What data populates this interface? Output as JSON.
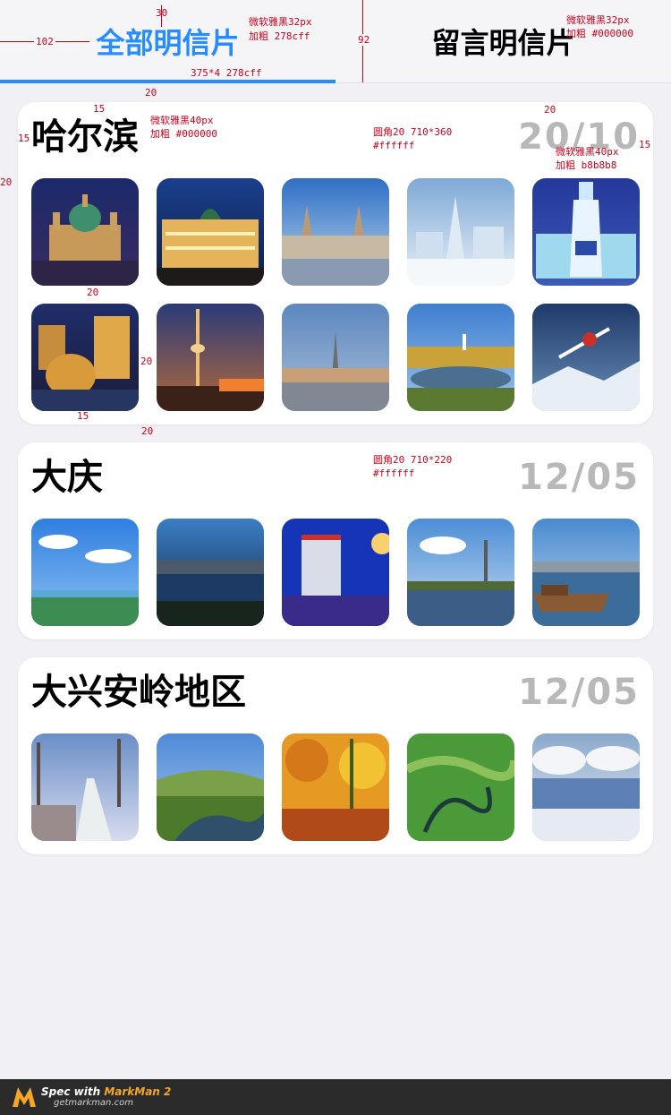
{
  "tabs": [
    {
      "label": "全部明信片",
      "active": true
    },
    {
      "label": "留言明信片",
      "active": false
    }
  ],
  "accent_color": "#278cff",
  "cities": [
    {
      "name": "哈尔滨",
      "date": "20/10",
      "photos": [
        {
          "label": "sophia-cathedral-night"
        },
        {
          "label": "european-building-night"
        },
        {
          "label": "city-gate-towers"
        },
        {
          "label": "ice-sculpture-tower"
        },
        {
          "label": "ice-bottle-sculpture"
        },
        {
          "label": "riverside-dome-night"
        },
        {
          "label": "tv-tower-dusk"
        },
        {
          "label": "flood-memorial-square"
        },
        {
          "label": "lakeside-pagoda"
        },
        {
          "label": "skier-jump"
        }
      ]
    },
    {
      "name": "大庆",
      "date": "12/05",
      "photos": [
        {
          "label": "wetland-blue-sky"
        },
        {
          "label": "city-river-dusk"
        },
        {
          "label": "hotel-night-moon"
        },
        {
          "label": "lake-tower"
        },
        {
          "label": "boat-on-lake"
        }
      ]
    },
    {
      "name": "大兴安岭地区",
      "date": "12/05",
      "photos": [
        {
          "label": "snowy-forest-road"
        },
        {
          "label": "green-valley-river"
        },
        {
          "label": "autumn-forest-lake"
        },
        {
          "label": "winding-river-meadow"
        },
        {
          "label": "frosty-lake"
        }
      ]
    }
  ],
  "annotations": {
    "tab_active_font": "微软雅黑32px",
    "tab_active_weight": "加粗 278cff",
    "tab_inactive_font": "微软雅黑32px",
    "tab_inactive_weight": "加粗 #000000",
    "underline": "375*4 278cff",
    "title_font": "微软雅黑40px",
    "title_weight": "加粗 #000000",
    "card1_spec": "圆角20 710*360",
    "card1_color": "#ffffff",
    "date_font": "微软雅黑40px",
    "date_weight": "加粗 b8b8b8",
    "card2_spec": "圆角20 710*220",
    "card2_color": "#ffffff",
    "m30": "30",
    "m102": "102",
    "m92": "92",
    "m20a": "20",
    "m15a": "15",
    "m15b": "15",
    "m20b": "20",
    "m15c": "15",
    "m20c": "20",
    "m20d": "20",
    "m20e": "20",
    "m15d": "15",
    "m20f": "20"
  },
  "footer": {
    "line1_prefix": "Spec with ",
    "line1_brand": "MarkMan 2",
    "line2": "getmarkman.com"
  }
}
